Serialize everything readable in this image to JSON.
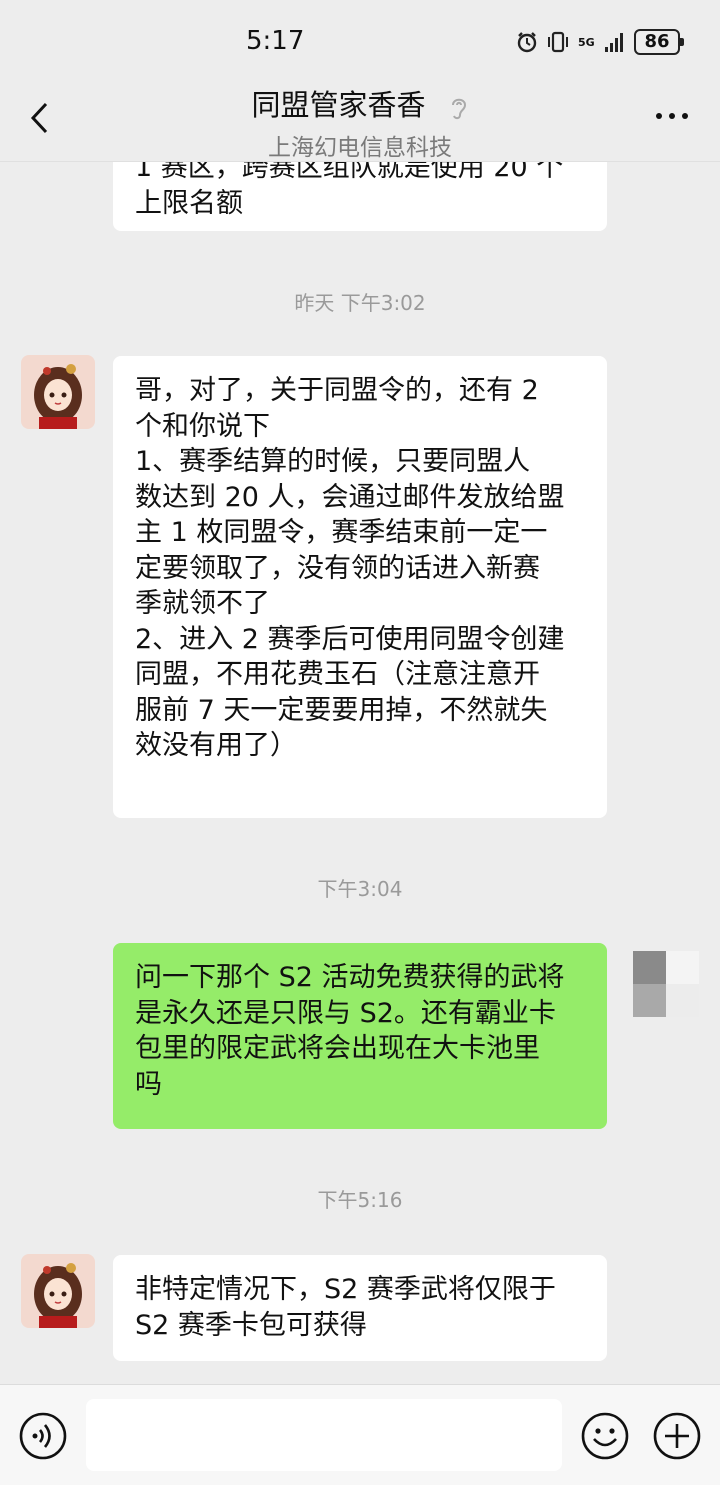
{
  "status": {
    "time": "5:17",
    "network": "5G",
    "battery": "86"
  },
  "header": {
    "title": "同盟管家香香",
    "subtitle": "上海幻电信息科技"
  },
  "messages": [
    {
      "type": "received",
      "text": "1 赛区，跨赛区组队就是使用 20 个\n上限名额"
    },
    {
      "type": "timestamp",
      "text": "昨天 下午3:02"
    },
    {
      "type": "received",
      "text": "哥，对了，关于同盟令的，还有 2\n个和你说下\n1、赛季结算的时候，只要同盟人\n数达到 20 人，会通过邮件发放给盟\n主 1 枚同盟令，赛季结束前一定一\n定要领取了，没有领的话进入新赛\n季就领不了\n2、进入 2 赛季后可使用同盟令创建\n同盟，不用花费玉石（注意注意开\n服前 7 天一定要要用掉，不然就失\n效没有用了）"
    },
    {
      "type": "timestamp",
      "text": "下午3:04"
    },
    {
      "type": "sent",
      "text": "问一下那个 S2 活动免费获得的武将\n是永久还是只限与 S2。还有霸业卡\n包里的限定武将会出现在大卡池里\n吗"
    },
    {
      "type": "timestamp",
      "text": "下午5:16"
    },
    {
      "type": "received",
      "text": "非特定情况下，S2 赛季武将仅限于\nS2 赛季卡包可获得"
    }
  ],
  "input": {
    "placeholder": ""
  },
  "icons": {
    "back": "chevron-left-icon",
    "ear": "ear-icon",
    "more": "more-dots-icon",
    "voice": "voice-icon",
    "emoji": "emoji-icon",
    "plus": "plus-icon"
  },
  "colors": {
    "background": "#ededed",
    "sent_bubble": "#95ec69",
    "received_bubble": "#ffffff",
    "timestamp": "#9a9a9a"
  }
}
